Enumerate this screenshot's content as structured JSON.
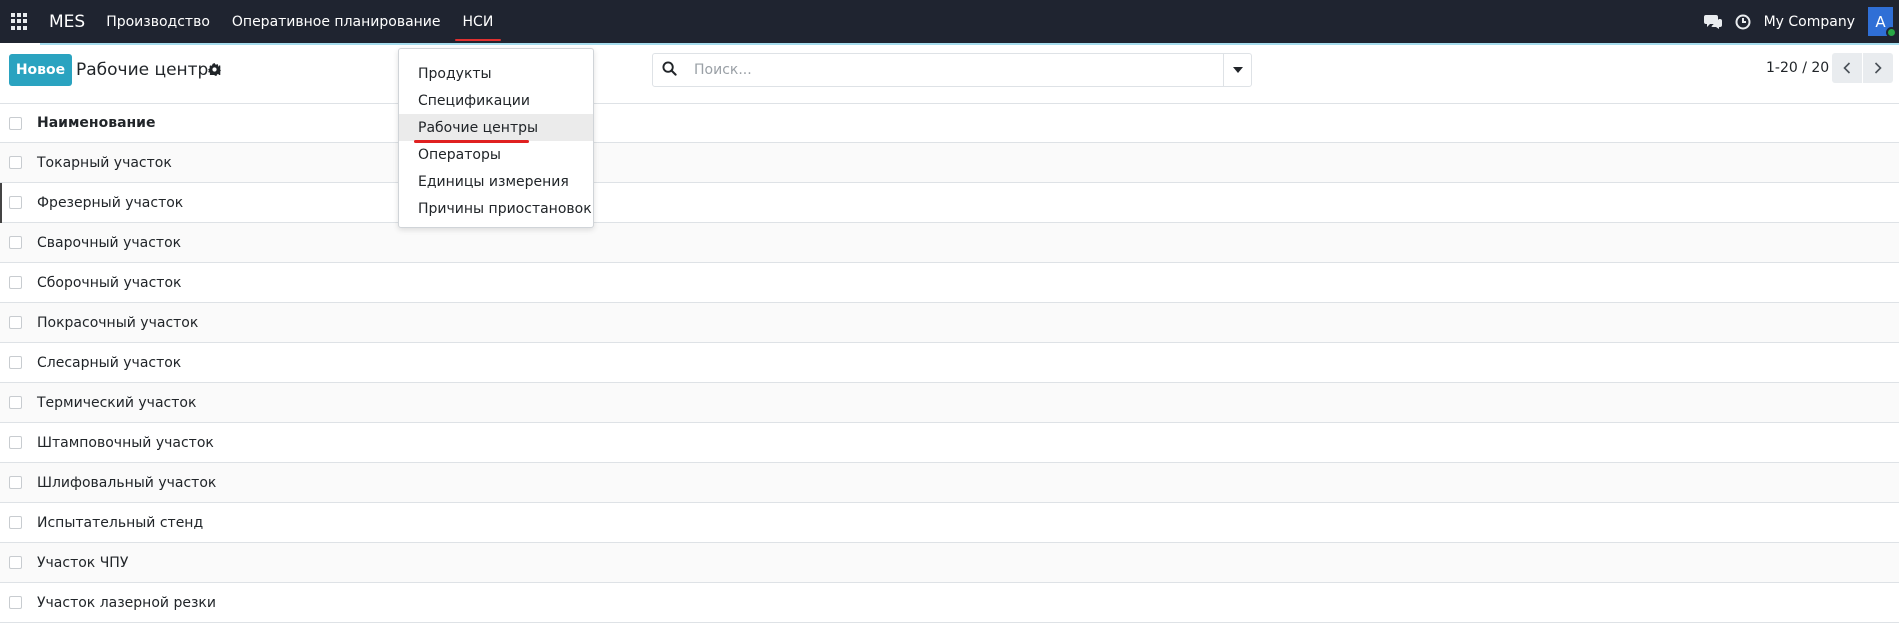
{
  "navbar": {
    "brand": "MES",
    "menu": [
      "Производство",
      "Оперативное планирование",
      "НСИ"
    ],
    "company": "My Company",
    "avatar_letter": "A"
  },
  "control": {
    "new_label": "Новое",
    "title": "Рабочие центры",
    "search_placeholder": "Поиск...",
    "pager": "1-20 / 20"
  },
  "dropdown": {
    "items": [
      "Продукты",
      "Спецификации",
      "Рабочие центры",
      "Операторы",
      "Единицы измерения",
      "Причины приостановок"
    ]
  },
  "list": {
    "header": "Наименование",
    "rows": [
      "Токарный участок",
      "Фрезерный участок",
      "Сварочный участок",
      "Сборочный участок",
      "Покрасочный участок",
      "Слесарный участок",
      "Термический участок",
      "Штамповочный участок",
      "Шлифовальный участок",
      "Испытательный стенд",
      "Участок ЧПУ",
      "Участок лазерной резки"
    ]
  },
  "colors": {
    "navbar_bg": "#1f2430",
    "primary_button": "#2aa3c0",
    "active_underline": "#e03030",
    "avatar": "#2f6fd6",
    "status_online": "#28a745"
  }
}
